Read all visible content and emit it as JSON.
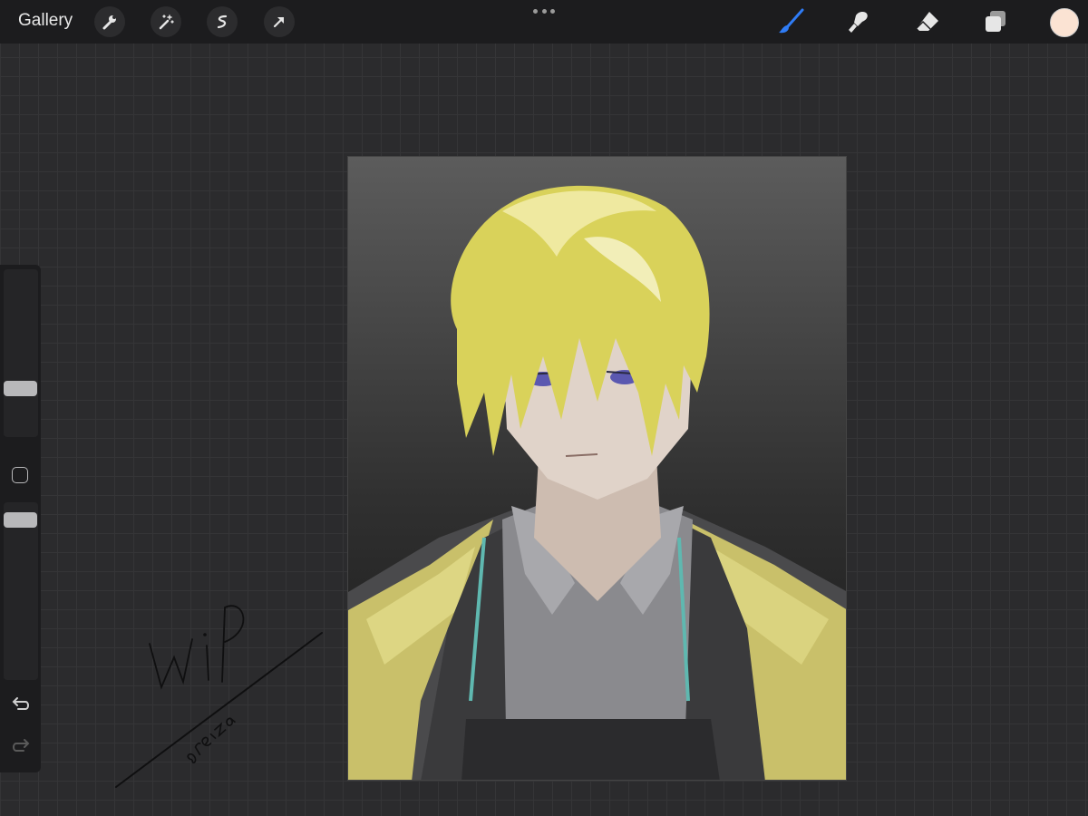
{
  "toolbar": {
    "gallery_label": "Gallery",
    "left_tools": [
      "wrench-icon",
      "magic-wand-icon",
      "selection-icon",
      "transform-arrow-icon"
    ],
    "right_tools": [
      "brush-icon",
      "smudge-icon",
      "eraser-icon",
      "layers-icon"
    ],
    "active_tool": "brush-icon",
    "accent_color": "#2f7cf6",
    "current_color": "#fbe3d3"
  },
  "sidebar": {
    "brush_size": 0.27,
    "opacity": 0.94
  },
  "canvas": {
    "signature_text": "wip",
    "artist_text": "oreiza"
  }
}
